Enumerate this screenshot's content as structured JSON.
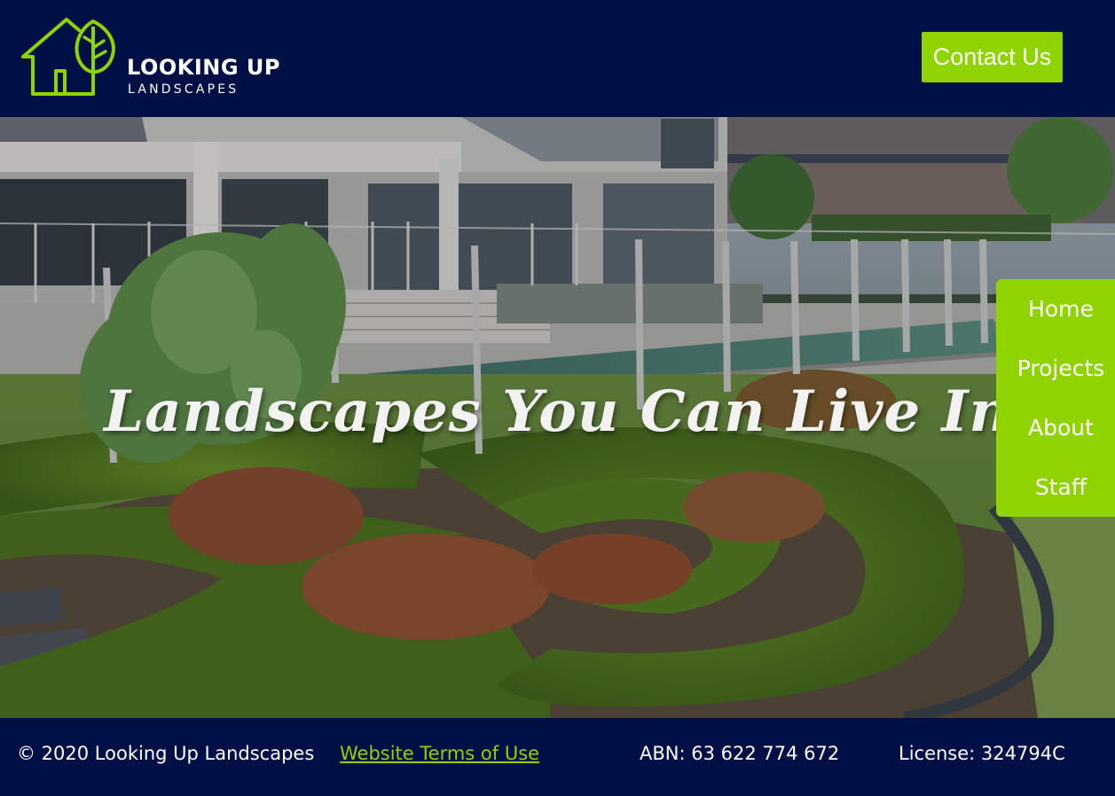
{
  "brand": {
    "name": "LOOKING UP",
    "subtitle": "LANDSCAPES",
    "logo_icon": "house-tree-icon",
    "accent_color": "#8fd400",
    "background_color": "#001046"
  },
  "header": {
    "contact_label": "Contact Us"
  },
  "hero": {
    "tagline": "Landscapes You Can Live In"
  },
  "nav": {
    "items": [
      {
        "label": "Home"
      },
      {
        "label": "Projects"
      },
      {
        "label": "About"
      },
      {
        "label": "Staff"
      }
    ]
  },
  "footer": {
    "copyright": "© 2020 Looking Up Landscapes",
    "terms_label": "Website Terms of Use",
    "abn": "ABN: 63 622 774 672",
    "license": "License: 324794C"
  }
}
